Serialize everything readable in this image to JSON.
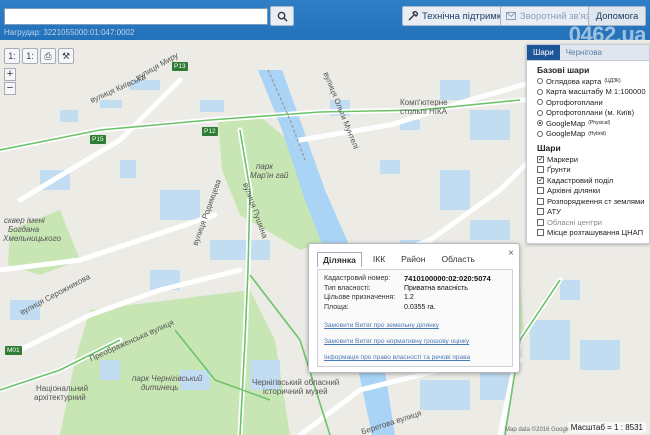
{
  "search": {
    "placeholder": "",
    "value": ""
  },
  "header": {
    "subtitle": "Нагрудар: 3221055000:01:047:0002",
    "brand": "0462.ua",
    "buttons": {
      "support": "Технічна підтримка",
      "feedback": "Зворотний зв'язок",
      "help": "Допомога"
    }
  },
  "tools": {
    "labels": [
      "1:",
      "1:",
      "⎙",
      "⚒"
    ]
  },
  "zoom": {
    "in": "+",
    "out": "−"
  },
  "map": {
    "labels": {
      "kyivska": "вулиця Київська",
      "mira": "вулиця Миру",
      "p13a": "P13",
      "p13b": "P13",
      "p15": "P15",
      "p12": "P12",
      "m01": "M01",
      "olhy": "вулиця Ольги Мунтелі",
      "kompyuterne": "Комп'ютерне",
      "stolny": "стольпі НІКА",
      "park": "парк",
      "mariin": "Мар'ін гай",
      "rodimtseva": "вулиця Родимцева",
      "pushkina": "вулиця Пушкіна",
      "skver1": "сквер імені",
      "skver2": "Богдана",
      "skver3": "Хмельницького",
      "serzhik": "вулиця Серожникова",
      "preobrazh": "Преображенська вулиця",
      "vyzvolna": "вулиця Шевченка",
      "natsional1": "Національний",
      "natsional2": "архітектурний",
      "park2": "парк Чернігівський",
      "park3": "дитинець",
      "museum1": "Чернігівський обласний",
      "museum2": "історичний музей",
      "berehova": "Берегова вулиця",
      "gray1": "вулиця Шевченка"
    },
    "copyright": "Map data ©2016 Google",
    "scale": "Масштаб = 1 : 8531"
  },
  "layers": {
    "tab_active": "Шари",
    "tab_inactive": "Чернігова",
    "base_title": "Базові шари",
    "base": [
      {
        "label": "Оглядова карта",
        "sup": "(ЦДЗК)",
        "selected": false
      },
      {
        "label": "Карта масштабу М 1:100000",
        "sup": "",
        "selected": false
      },
      {
        "label": "Ортофотоплани",
        "sup": "",
        "selected": false
      },
      {
        "label": "Ортофотоплани (м. Київ)",
        "sup": "",
        "selected": false
      },
      {
        "label": "GoogleMap",
        "sup": "(Physical)",
        "selected": true
      },
      {
        "label": "GoogleMap",
        "sup": "(Hybrid)",
        "selected": false
      }
    ],
    "layers_title": "Шари",
    "overlays": [
      {
        "label": "Маркери",
        "checked": true,
        "grey": false
      },
      {
        "label": "Ґрунти",
        "checked": false,
        "grey": false
      },
      {
        "label": "Кадастровий поділ",
        "checked": true,
        "grey": false
      },
      {
        "label": "Архівні ділянки",
        "checked": false,
        "grey": false
      },
      {
        "label": "Розпорядження ст землями",
        "checked": false,
        "grey": false
      },
      {
        "label": "АТУ",
        "checked": false,
        "grey": false
      },
      {
        "label": "Обласні центри",
        "checked": false,
        "grey": true
      },
      {
        "label": "Місце розташування ЦНАП",
        "checked": false,
        "grey": false
      }
    ]
  },
  "popup": {
    "tabs": [
      "Ділянка",
      "ІКК",
      "Район",
      "Область"
    ],
    "close": "×",
    "fields": [
      {
        "k": "Кадастровий номер:",
        "v": "7410100000:02:020:5074",
        "bold": true
      },
      {
        "k": "Тип власності:",
        "v": "Приватна власність",
        "bold": false
      },
      {
        "k": "Цільове призначення:",
        "v": "1.2",
        "bold": false
      },
      {
        "k": "Площа:",
        "v": "0.0355 га.",
        "bold": false
      }
    ],
    "links": [
      "Замовити Витяг про земельну ділянку",
      "Замовити Витяг про нормативну грошову оцінку",
      "Інформація про право власності та речові права"
    ]
  },
  "colors": {
    "header": "#2a78c2",
    "water": "#a9d4f5",
    "park": "#c8e6b4",
    "road": "#ffffff",
    "road_highlight": "#6cc36c",
    "buildings": "#c2dcf2"
  }
}
